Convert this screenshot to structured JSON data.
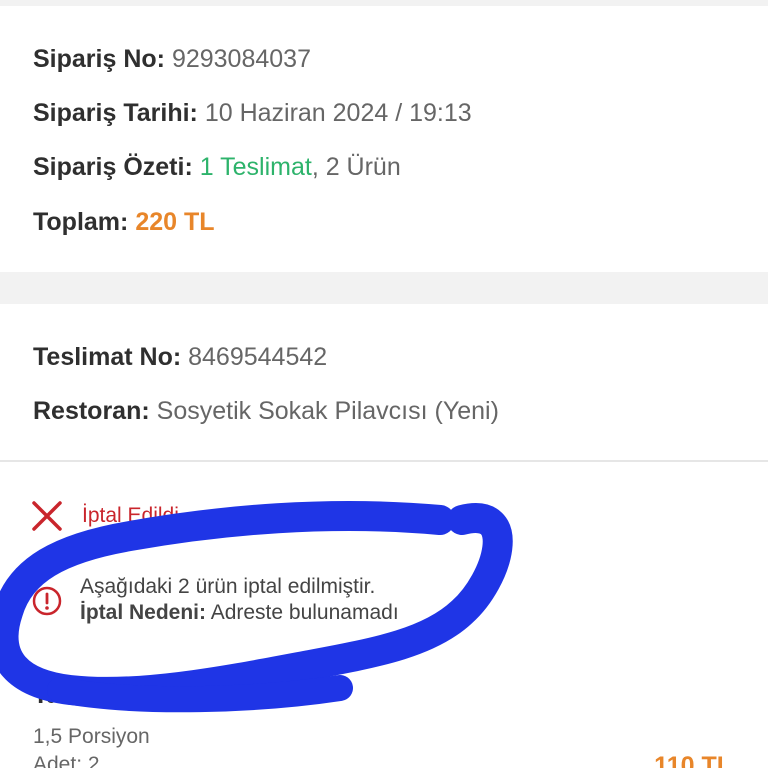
{
  "order": {
    "number_label": "Sipariş No:",
    "number_value": "9293084037",
    "date_label": "Sipariş Tarihi:",
    "date_value": "10 Haziran 2024 / 19:13",
    "summary_label": "Sipariş Özeti:",
    "summary_deliveries": "1 Teslimat",
    "summary_items": ", 2 Ürün",
    "total_label": "Toplam:",
    "total_value": "220 TL"
  },
  "delivery": {
    "number_label": "Teslimat No:",
    "number_value": "8469544542",
    "restaurant_label": "Restoran:",
    "restaurant_value": "Sosyetik Sokak Pilavcısı (Yeni)",
    "status": "İptal Edildi",
    "notice_line1": "Aşağıdaki 2 ürün iptal edilmiştir.",
    "notice_reason_label": "İptal Nedeni:",
    "notice_reason_value": "Adreste bulunamadı",
    "product_name": "Tavuklu Pilav",
    "product_portion": "1,5 Porsiyon",
    "product_qty": "Adet: 2",
    "product_price": "110 TL"
  },
  "colors": {
    "accent_green": "#2db36b",
    "accent_orange": "#e8862a",
    "cancel_red": "#c9252c",
    "scribble_blue": "#1f35e6"
  },
  "icons": {
    "status": "close-icon",
    "notice": "info-icon"
  }
}
